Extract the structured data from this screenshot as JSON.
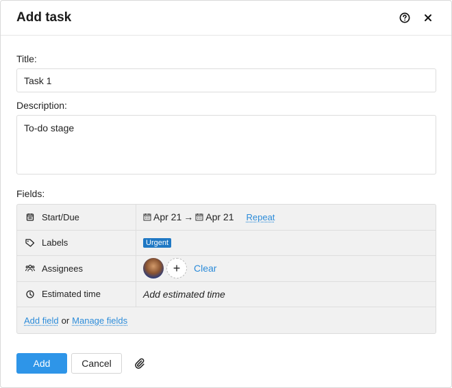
{
  "dialog": {
    "title": "Add task",
    "help_icon": "help-circle-icon",
    "close_icon": "close-icon"
  },
  "form": {
    "title_label": "Title:",
    "title_value": "Task 1",
    "description_label": "Description:",
    "description_value": "To-do stage",
    "fields_label": "Fields:"
  },
  "fields": {
    "start_due": {
      "name": "Start/Due",
      "start": "Apr 21",
      "arrow": "→",
      "due": "Apr 21",
      "repeat": "Repeat"
    },
    "labels": {
      "name": "Labels",
      "badge": "Urgent",
      "badge_color": "#1f78c4"
    },
    "assignees": {
      "name": "Assignees",
      "add": "+",
      "clear": "Clear"
    },
    "estimated_time": {
      "name": "Estimated time",
      "placeholder": "Add estimated time"
    },
    "footer": {
      "add_field": "Add field",
      "or": "or",
      "manage_fields": "Manage fields"
    }
  },
  "buttons": {
    "add": "Add",
    "cancel": "Cancel",
    "attach_icon": "paperclip-icon"
  },
  "colors": {
    "accent": "#2e95e8",
    "link": "#2b8bd9"
  }
}
